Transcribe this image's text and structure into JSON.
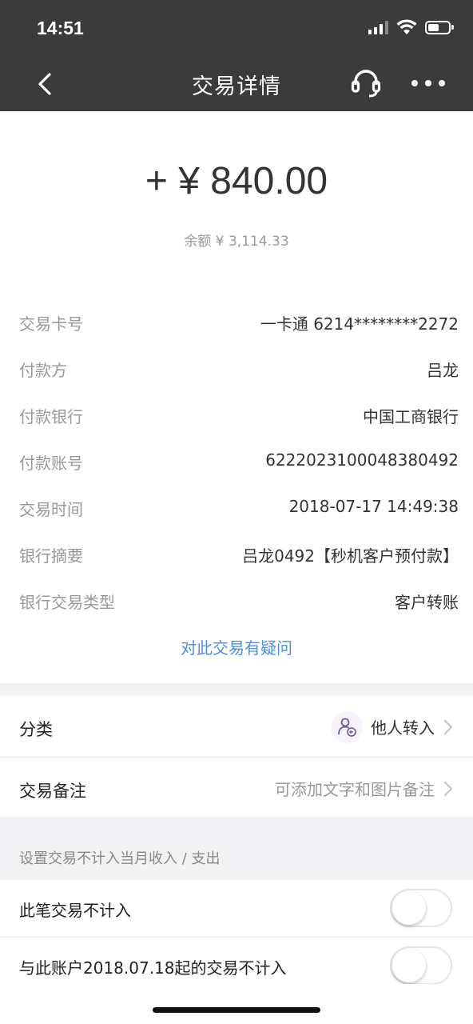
{
  "status_bar": {
    "time": "14:51",
    "battery_level": 0.55
  },
  "nav": {
    "title": "交易详情",
    "back_icon": "chevron-left-icon",
    "support_icon": "headset-icon",
    "more_icon": "more-horizontal-icon"
  },
  "transaction": {
    "amount": "+ ¥ 840.00",
    "balance": "余额 ¥ 3,114.33",
    "details": [
      {
        "label": "交易卡号",
        "value": "一卡通 6214********2272"
      },
      {
        "label": "付款方",
        "value": "吕龙"
      },
      {
        "label": "付款银行",
        "value": "中国工商银行"
      },
      {
        "label": "付款账号",
        "value": "6222023100048380492"
      },
      {
        "label": "交易时间",
        "value": "2018-07-17 14:49:38"
      },
      {
        "label": "银行摘要",
        "value": "吕龙0492【秒机客户预付款】"
      },
      {
        "label": "银行交易类型",
        "value": "客户转账"
      }
    ],
    "query_link": "对此交易有疑问"
  },
  "category": {
    "label": "分类",
    "value": "他人转入",
    "icon": "person-transfer-icon"
  },
  "note": {
    "label": "交易备注",
    "placeholder": "可添加文字和图片备注"
  },
  "exclude_section": {
    "header": "设置交易不计入当月收入 / 支出",
    "toggles": [
      {
        "label": "此笔交易不计入",
        "on": false
      },
      {
        "label": "与此账户2018.07.18起的交易不计入",
        "on": false
      }
    ]
  },
  "colors": {
    "header_bg": "#3b3b3b",
    "link": "#4a90e2"
  }
}
